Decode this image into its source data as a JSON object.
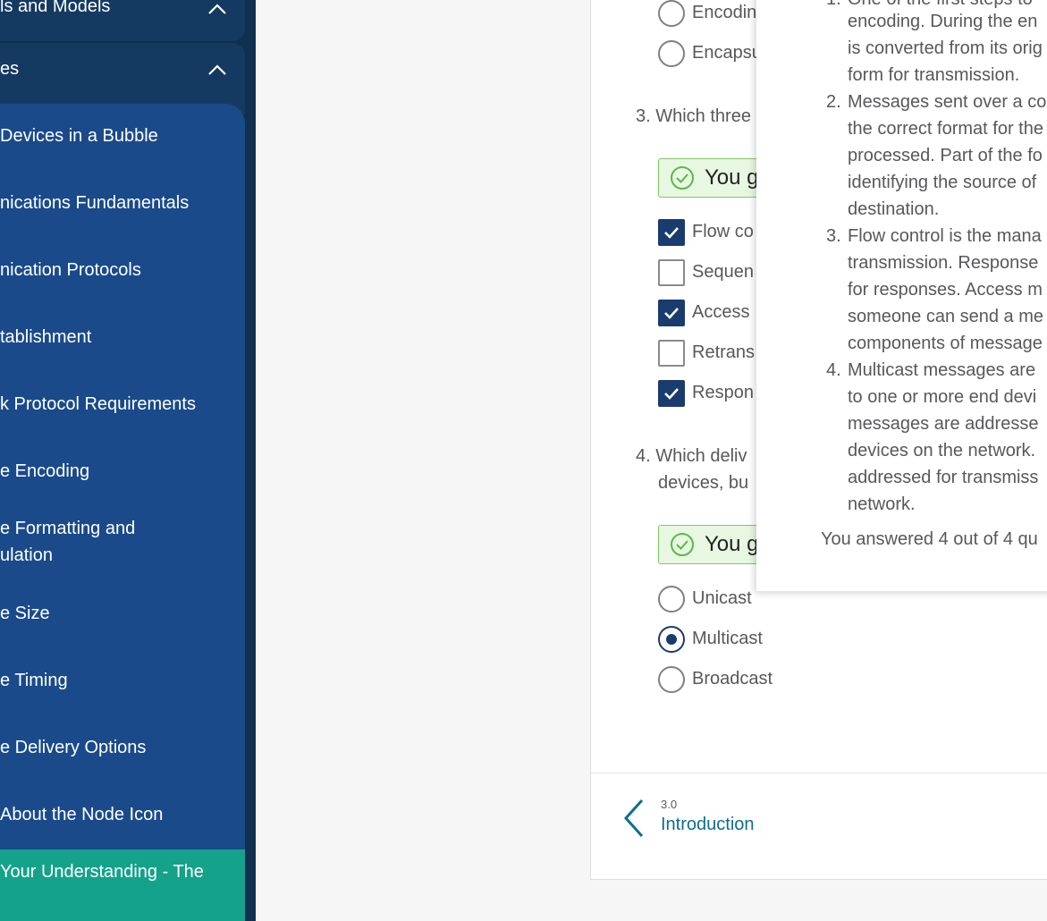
{
  "sidebar": {
    "section_1": {
      "label": "ls and Models"
    },
    "section_2": {
      "label": "es"
    },
    "topics": [
      {
        "lines": [
          "Devices in a Bubble"
        ]
      },
      {
        "lines": [
          "nications Fundamentals"
        ]
      },
      {
        "lines": [
          "nication Protocols"
        ]
      },
      {
        "lines": [
          "tablishment"
        ]
      },
      {
        "lines": [
          "k Protocol Requirements"
        ]
      },
      {
        "lines": [
          "e Encoding"
        ]
      },
      {
        "lines": [
          "e Formatting and",
          "ulation"
        ]
      },
      {
        "lines": [
          "e Size"
        ]
      },
      {
        "lines": [
          "e Timing"
        ]
      },
      {
        "lines": [
          "e Delivery Options"
        ]
      },
      {
        "lines": [
          "About the Node Icon"
        ]
      },
      {
        "lines": [
          "Your Understanding - The"
        ],
        "active": true
      }
    ]
  },
  "quiz": {
    "q2_options": [
      "Encodin",
      "Encapsu"
    ],
    "q3": {
      "prompt": "3. Which three",
      "feedback": "You g",
      "options": [
        {
          "label": "Flow co",
          "checked": true
        },
        {
          "label": "Sequen",
          "checked": false
        },
        {
          "label": "Access",
          "checked": true
        },
        {
          "label": "Retrans",
          "checked": false
        },
        {
          "label": "Respon",
          "checked": true
        }
      ]
    },
    "q4": {
      "prompt_line1": "4. Which deliv",
      "prompt_line2": "devices, bu",
      "feedback": "You g",
      "options": [
        {
          "label": "Unicast",
          "selected": false
        },
        {
          "label": "Multicast",
          "selected": true
        },
        {
          "label": "Broadcast",
          "selected": false
        }
      ]
    }
  },
  "nav": {
    "prev_number": "3.0",
    "prev_title": "Introduction"
  },
  "popup": {
    "items": [
      {
        "number": "1.",
        "lines": [
          "One of the first steps to",
          "encoding. During the en",
          "is converted from its orig",
          "form for transmission."
        ]
      },
      {
        "number": "2.",
        "lines": [
          "Messages sent over a co",
          "the correct format for the",
          "processed. Part of the fo",
          "identifying the source of",
          "destination."
        ]
      },
      {
        "number": "3.",
        "lines": [
          "Flow control is the mana",
          "transmission. Response",
          "for responses. Access m",
          "someone can send a me",
          "components of message"
        ]
      },
      {
        "number": "4.",
        "lines": [
          "Multicast messages are",
          "to one or more end devi",
          "messages are addresse",
          "devices on the network.",
          "addressed for transmiss",
          "network."
        ]
      }
    ],
    "summary": "You answered 4 out of 4 qu"
  },
  "colors": {
    "sidebar_bg": "#112f4e",
    "topic_bg": "#1a4a8a",
    "active_topic": "#14a28a",
    "accent_dark_blue": "#1a3b6e",
    "link_teal": "#0d6e8c",
    "feedback_green": "#e8f7e1"
  }
}
